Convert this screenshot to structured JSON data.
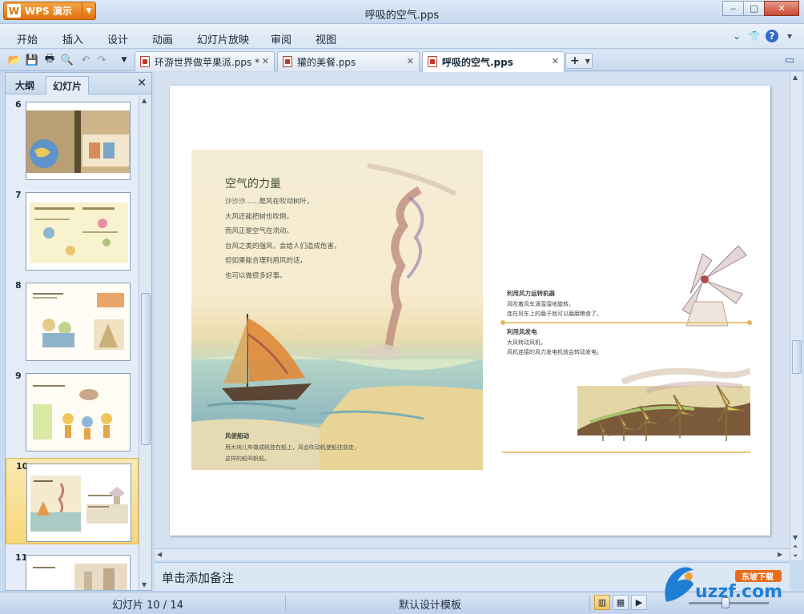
{
  "window": {
    "app_button": "WPS 演示",
    "doc_title": "呼吸的空气.pps",
    "min": "‒",
    "max": "□",
    "close": "✕"
  },
  "menu": {
    "items": [
      "开始",
      "插入",
      "设计",
      "动画",
      "幻灯片放映",
      "审阅",
      "视图"
    ]
  },
  "tabs": [
    {
      "label": "环游世界做苹果派.pps *",
      "active": false
    },
    {
      "label": "獾的美餐.pps",
      "active": false
    },
    {
      "label": "呼吸的空气.pps",
      "active": true
    }
  ],
  "panel": {
    "tabs": [
      "大纲",
      "幻灯片"
    ],
    "active_tab": "幻灯片",
    "slides": [
      "6",
      "7",
      "8",
      "9",
      "10",
      "11"
    ],
    "selected": "10"
  },
  "slide": {
    "left_title": "空气的力量",
    "left_lines": [
      "沙沙沙……是风在吹动树叶，",
      "大风还能把树也吹倒，",
      "而风正是空气在流动。",
      "台风之类的强风，会给人们造成危害，",
      "但如果能合理利用风的话，",
      "也可以做很多好事。"
    ],
    "caption_title": "风使船动",
    "caption_lines": [
      "用大块儿布做成帆挂在船上，风会吹动帆使船往前走，",
      "这样的船叫帆船。"
    ],
    "right_block1_title": "利用风力运转机器",
    "right_block1_lines": [
      "风吹着风车滴溜溜地旋转，",
      "连在风车上的磨子就可以磨磨粮食了。"
    ],
    "right_block2_title": "利用风发电",
    "right_block2_lines": [
      "大风转动风机，",
      "风机连接的风力发电机就会转动发电。"
    ]
  },
  "notes": {
    "placeholder": "单击添加备注"
  },
  "status": {
    "slide_indicator": "幻灯片 10 / 14",
    "template": "默认设计模板"
  },
  "watermark": {
    "text": "uzzf.com",
    "badge": "东坡下载"
  },
  "colors": {
    "accent_orange": "#e0720c",
    "selected_slide": "#f6d77a",
    "chrome_blue": "#c9dbf0"
  }
}
